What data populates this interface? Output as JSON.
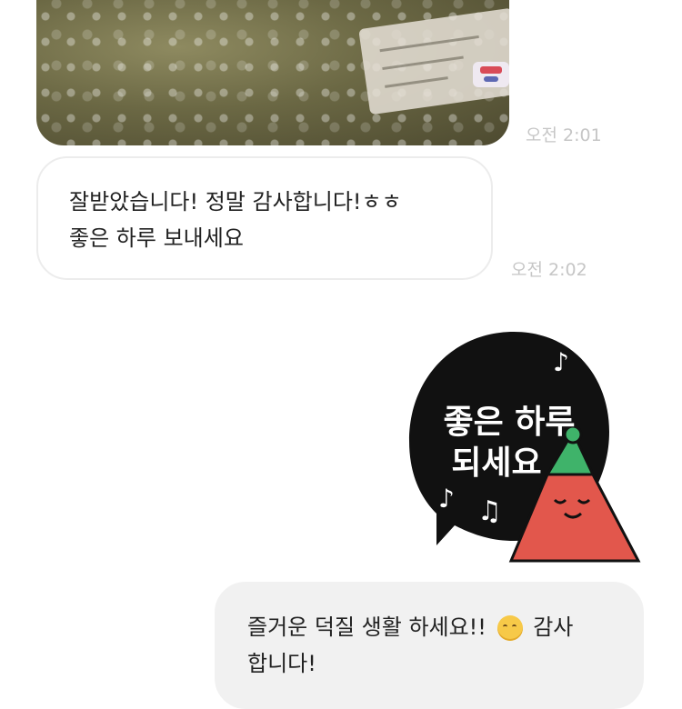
{
  "messages": {
    "photo_time": "오전 2:01",
    "incoming": {
      "line1": "잘받았습니다! 정말 감사합니다!ㅎㅎ",
      "line2": "좋은 하루 보내세요",
      "time": "오전 2:02"
    },
    "sticker": {
      "line1": "좋은 하루",
      "line2": "되세요"
    },
    "outgoing": {
      "line1": "즐거운 덕질 생활 하세요!!",
      "emoji": "smiling-face-emoji",
      "line1_tail": "감사",
      "line2": "합니다!"
    }
  },
  "colors": {
    "bubble_in_bg": "#ffffff",
    "bubble_out_bg": "#f1f1f1",
    "time_text": "#c6c6c6",
    "sticker_bg": "#111111",
    "sticker_hat": "#3fb36a",
    "sticker_body": "#e2574c"
  }
}
